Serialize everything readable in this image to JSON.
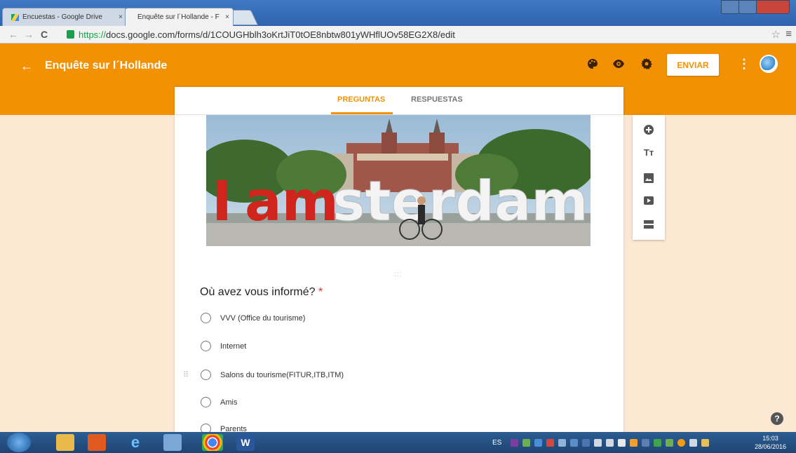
{
  "browser": {
    "tabs": [
      {
        "label": "Encuestas - Google Drive",
        "close": "×"
      },
      {
        "label": "Enquête sur l´Hollande - F",
        "close": "×"
      }
    ],
    "address": {
      "https": "https://",
      "rest": "docs.google.com/forms/d/1COUGHblh3oKrtJiT0tOE8nbtw801yWHflUOv58EG2X8/edit"
    }
  },
  "header": {
    "title": "Enquête sur l´Hollande",
    "send_label": "ENVIAR"
  },
  "form": {
    "tabs": [
      "PREGUNTAS",
      "RESPUESTAS"
    ],
    "banner_words": "Iamsterdam",
    "question": "Où avez vous informé?",
    "required_mark": "*",
    "options": [
      "VVV (Office du tourisme)",
      "Internet",
      "Salons du tourisme(FITUR,ITB,ITM)",
      "Amis",
      "Parents"
    ]
  },
  "taskbar": {
    "lang": "ES",
    "time": "15:03",
    "date": "28/06/2016"
  },
  "colors": {
    "accent": "#f29104",
    "background": "#fde9d3"
  }
}
